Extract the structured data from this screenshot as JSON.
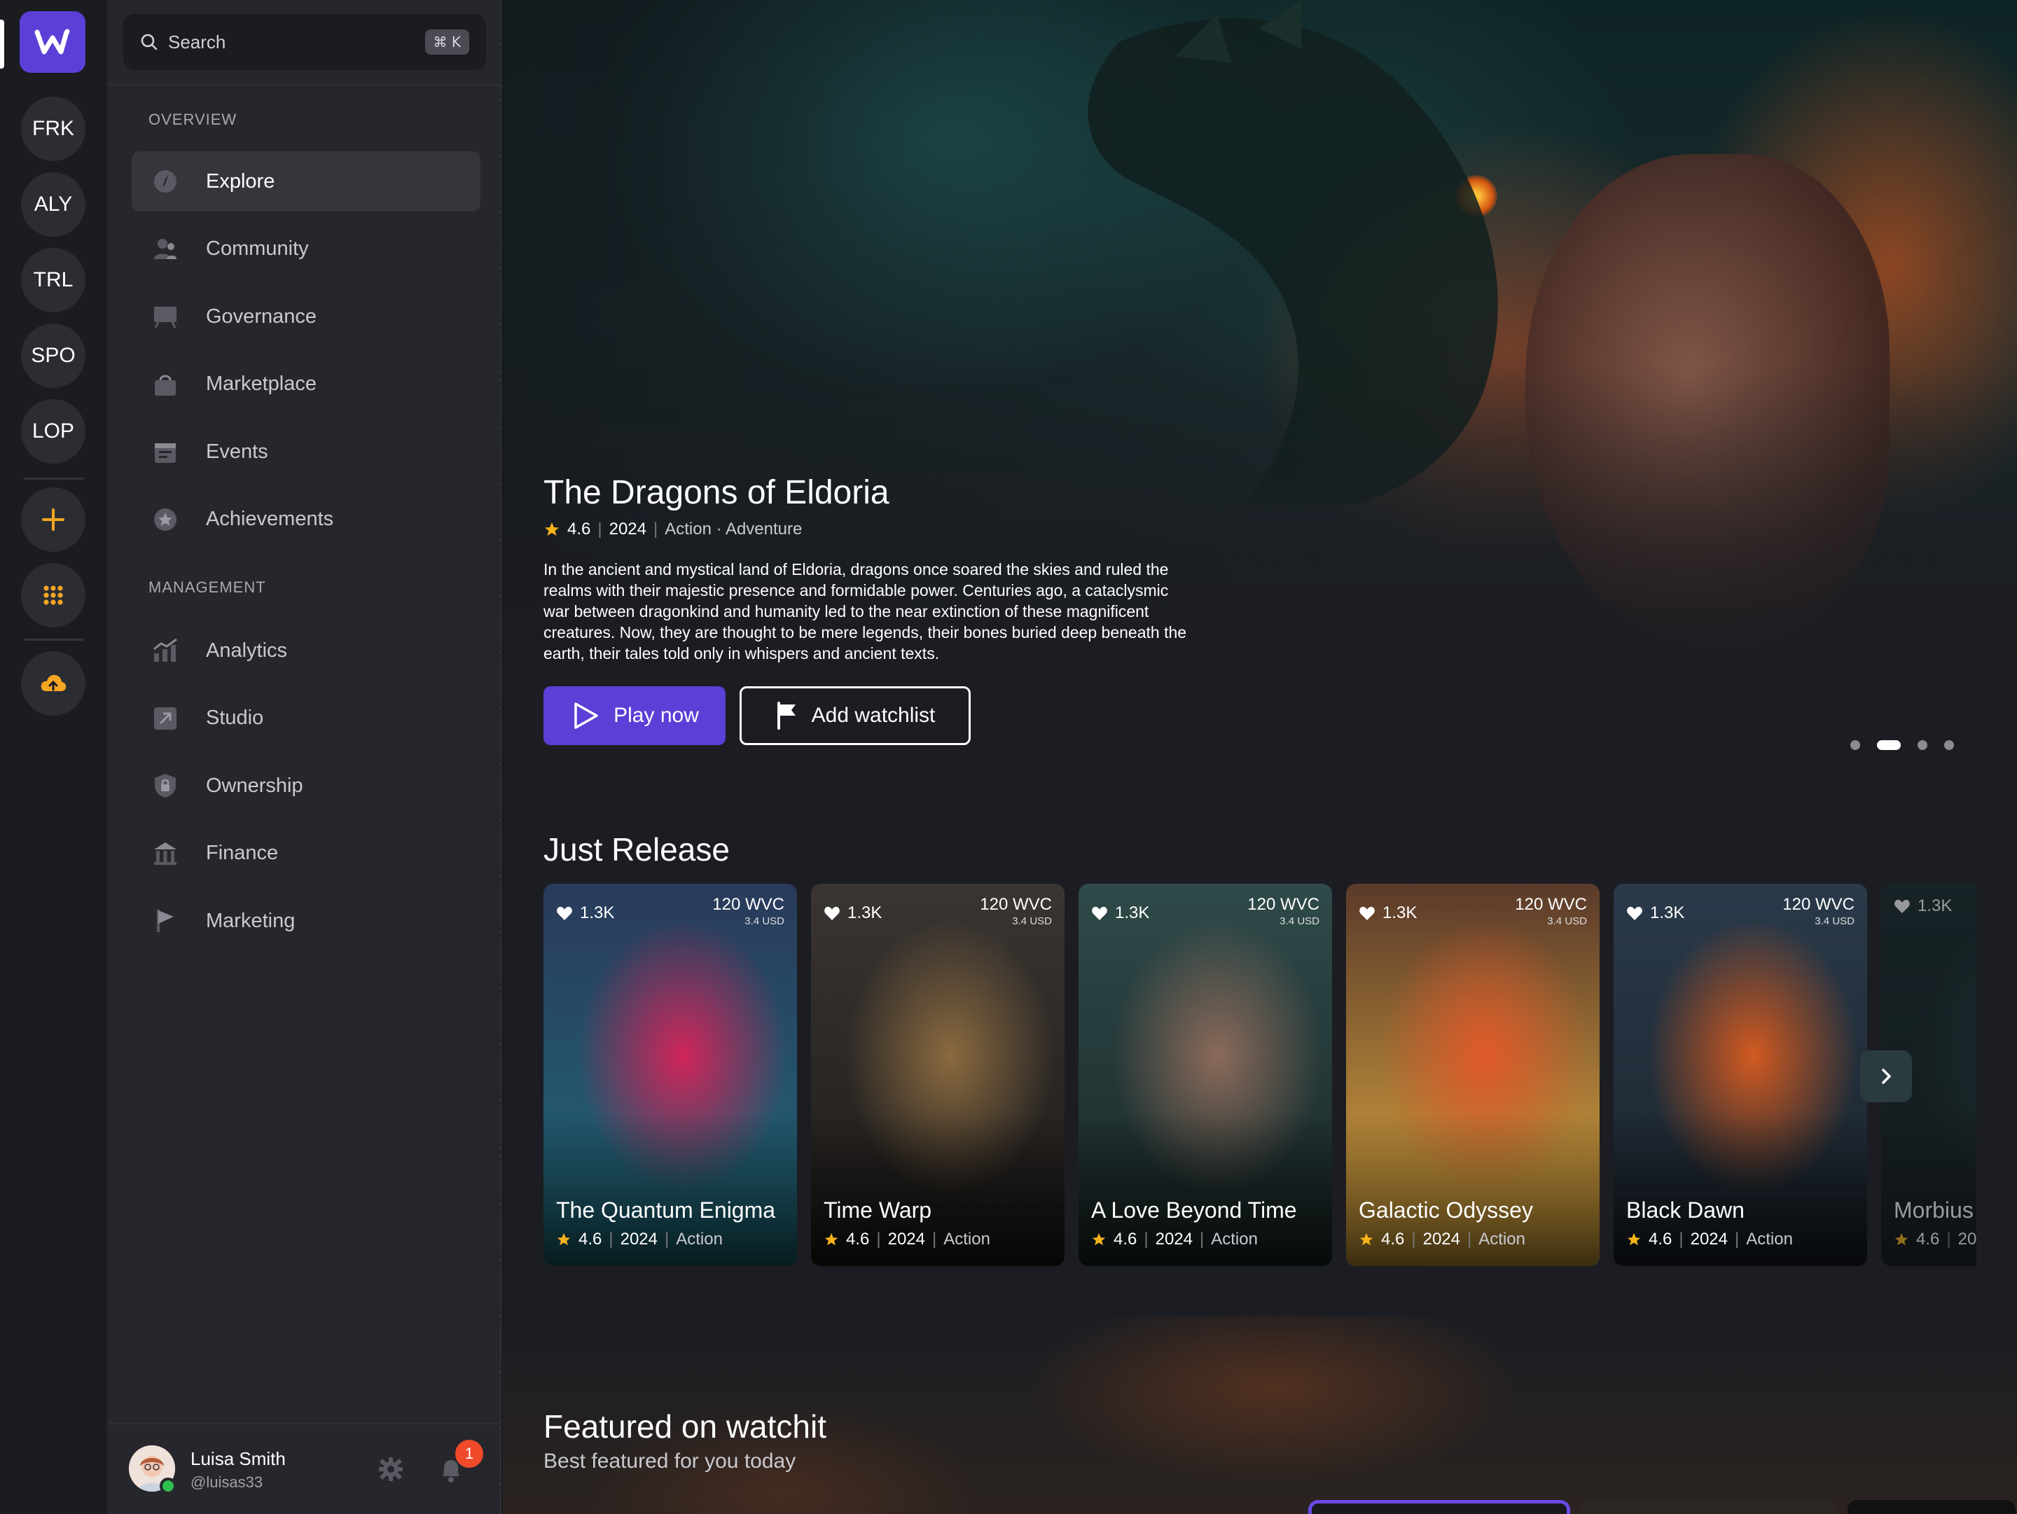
{
  "rail": {
    "logo": "W",
    "servers": [
      "FRK",
      "ALY",
      "TRL",
      "SPO",
      "LOP"
    ],
    "add_icon": "plus-icon",
    "apps_icon": "grid-icon",
    "upload_icon": "cloud-upload-icon",
    "accent": "#f5a623"
  },
  "search": {
    "placeholder": "Search",
    "shortcut": "⌘ K"
  },
  "sidebar": {
    "overview_title": "OVERVIEW",
    "overview": [
      {
        "label": "Explore",
        "icon": "compass-icon",
        "active": true
      },
      {
        "label": "Community",
        "icon": "people-icon"
      },
      {
        "label": "Governance",
        "icon": "podium-icon"
      },
      {
        "label": "Marketplace",
        "icon": "bag-icon"
      },
      {
        "label": "Events",
        "icon": "calendar-icon"
      },
      {
        "label": "Achievements",
        "icon": "star-badge-icon"
      }
    ],
    "management_title": "MANAGEMENT",
    "management": [
      {
        "label": "Analytics",
        "icon": "chart-icon"
      },
      {
        "label": "Studio",
        "icon": "studio-icon"
      },
      {
        "label": "Ownership",
        "icon": "lock-icon"
      },
      {
        "label": "Finance",
        "icon": "bank-icon"
      },
      {
        "label": "Marketing",
        "icon": "flag-icon"
      }
    ]
  },
  "user": {
    "name": "Luisa Smith",
    "handle": "@luisas33",
    "notifications": "1"
  },
  "hero": {
    "title": "The Dragons of Eldoria",
    "rating": "4.6",
    "year": "2024",
    "genres": "Action · Adventure",
    "description": "In the ancient and mystical land of Eldoria, dragons once soared the skies and ruled the realms with their majestic presence and formidable power. Centuries ago, a cataclysmic war between dragonkind and humanity led to the near extinction of these magnificent creatures. Now, they are thought to be mere legends, their bones buried deep beneath the earth, their tales told only in whispers and ancient texts.",
    "play_label": "Play now",
    "watch_label": "Add watchlist",
    "slide_active": 2,
    "slide_count": 4
  },
  "just_release": {
    "title": "Just Release",
    "cards": [
      {
        "title": "The Quantum Enigma",
        "likes": "1.3K",
        "price": "120 WVC",
        "usd": "3.4 USD",
        "rating": "4.6",
        "year": "2024",
        "genre": "Action",
        "colors": [
          "#2a3a5a",
          "#d0255a",
          "#1e6a7a"
        ]
      },
      {
        "title": "Time Warp",
        "likes": "1.3K",
        "price": "120 WVC",
        "usd": "3.4 USD",
        "rating": "4.6",
        "year": "2024",
        "genre": "Action",
        "colors": [
          "#3a3532",
          "#8a6a40",
          "#1c1a18"
        ]
      },
      {
        "title": "A Love Beyond Time",
        "likes": "1.3K",
        "price": "120 WVC",
        "usd": "3.4 USD",
        "rating": "4.6",
        "year": "2024",
        "genre": "Action",
        "colors": [
          "#2f4a4a",
          "#8a6a5a",
          "#1a2626"
        ]
      },
      {
        "title": "Galactic Odyssey",
        "likes": "1.3K",
        "price": "120 WVC",
        "usd": "3.4 USD",
        "rating": "4.6",
        "year": "2024",
        "genre": "Action",
        "colors": [
          "#5a3a2a",
          "#e0592a",
          "#e6b040"
        ]
      },
      {
        "title": "Black Dawn",
        "likes": "1.3K",
        "price": "120 WVC",
        "usd": "3.4 USD",
        "rating": "4.6",
        "year": "2024",
        "genre": "Action",
        "colors": [
          "#2a3a4a",
          "#d25a20",
          "#1a222a"
        ]
      },
      {
        "title": "Morbius",
        "likes": "1.3K",
        "price": "",
        "usd": "",
        "rating": "4.6",
        "year": "20",
        "genre": "",
        "colors": [
          "#13282a",
          "#1c3a3a",
          "#0e1a1a"
        ]
      }
    ],
    "slide_active": 2,
    "slide_count": 4
  },
  "featured": {
    "title": "Featured on watchit",
    "subtitle": "Best featured for you today"
  }
}
